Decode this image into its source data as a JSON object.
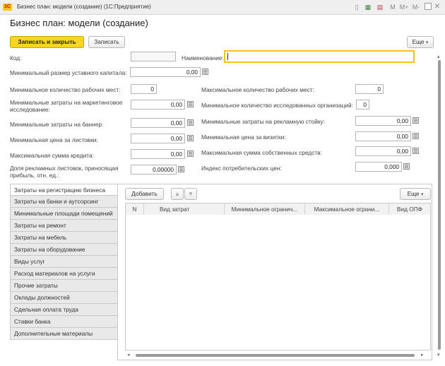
{
  "window": {
    "app_logo": "1С",
    "title": "Бизнес план: модели (создание)  (1С:Предприятие)",
    "controls": [
      "M",
      "M+",
      "M-"
    ]
  },
  "form": {
    "title": "Бизнес план: модели (создание)",
    "save_close_label": "Записать и закрыть",
    "save_label": "Записать",
    "more_label": "Еще"
  },
  "fields": {
    "code": {
      "label": "Код:",
      "value": ""
    },
    "name": {
      "label": "Наименование:",
      "value": ""
    },
    "min_capital": {
      "label": "Минимальный размер уставного капитала:",
      "value": "0,00"
    },
    "min_jobs": {
      "label": "Минимальное количество рабочих мест:",
      "value": "0"
    },
    "max_jobs": {
      "label": "Максимальное количество рабочих мест:",
      "value": "0"
    },
    "min_marketing": {
      "label": "Минимальные затраты на маркетинговое исследование:",
      "value": "0,00"
    },
    "min_orgs": {
      "label": "Минимальное количество исследованных организаций:",
      "value": "0"
    },
    "min_banner": {
      "label": "Минимальные затраты на баннер:",
      "value": "0,00"
    },
    "min_ad_stand": {
      "label": "Минимальные затраты на рекламную стойку:",
      "value": "0,00"
    },
    "min_leaflet": {
      "label": "Минимальная цена за листовки:",
      "value": "0,00"
    },
    "min_cards": {
      "label": "Минимальная цена за визитки:",
      "value": "0,00"
    },
    "max_credit": {
      "label": "Максимальная сумма кредита:",
      "value": "0,00"
    },
    "max_own_funds": {
      "label": "Максимальная сумма собственных средств:",
      "value": "0,00"
    },
    "leaflet_profit": {
      "label": "Доля рекламных листовок, приносящая прибыль, отн. ед.:",
      "value": "0,00000"
    },
    "consumer_index": {
      "label": "Индекс потребительских цен:",
      "value": "0,000"
    }
  },
  "tabs": [
    "Затраты на регистрацию бизнеса",
    "Затраты на банки и аутсорсинг",
    "Минимальные площади помещений",
    "Затраты на ремонт",
    "Затраты на мебель",
    "Затраты на оборудование",
    "Виды услуг",
    "Расход материалов на услуги",
    "Прочие затраты",
    "Оклады должностей",
    "Сдельная оплата труда",
    "Ставки банка",
    "Дополнительные материалы"
  ],
  "table": {
    "add_label": "Добавить",
    "up_icon": "arrow-up-icon",
    "down_icon": "arrow-down-icon",
    "more_label": "Еще",
    "columns": [
      "N",
      "Вид затрат",
      "Минимальное огранич...",
      "Максимальное ограни...",
      "Вид ОПФ"
    ]
  }
}
